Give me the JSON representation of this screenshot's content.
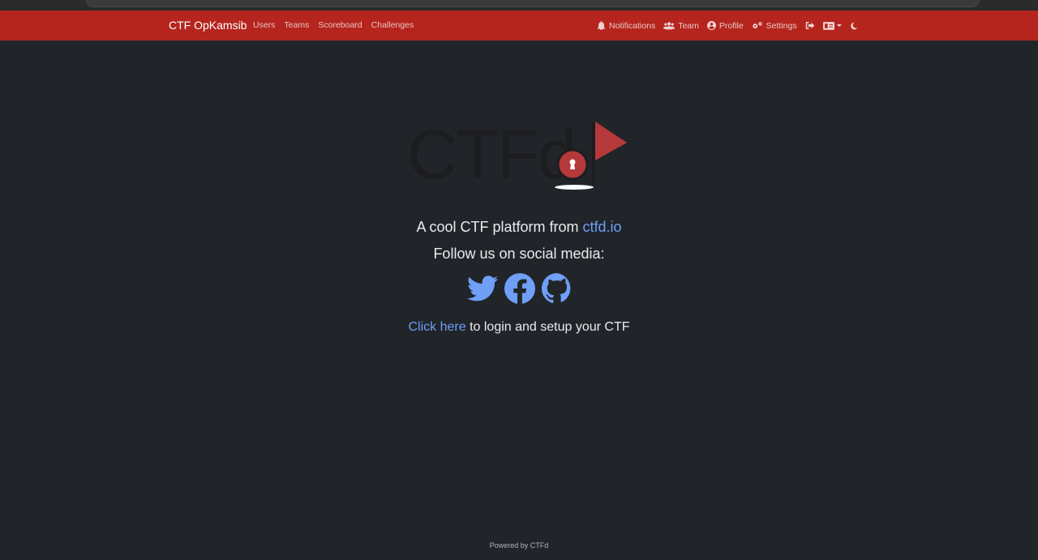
{
  "navbar": {
    "brand": "CTF OpKamsib",
    "links": [
      "Users",
      "Teams",
      "Scoreboard",
      "Challenges"
    ],
    "right": {
      "notifications": "Notifications",
      "team": "Team",
      "profile": "Profile",
      "settings": "Settings"
    }
  },
  "logo": {
    "text": "CTFd",
    "flag_color": "#b5393b"
  },
  "main": {
    "tagline_prefix": "A cool CTF platform from ",
    "tagline_link": "ctfd.io",
    "follow_text": "Follow us on social media:",
    "social": [
      "twitter-icon",
      "facebook-icon",
      "github-icon"
    ],
    "login_link": "Click here",
    "login_suffix": " to login and setup your CTF"
  },
  "footer": {
    "text": "Powered by CTFd"
  },
  "colors": {
    "navbar": "#b5251e",
    "background": "#212529",
    "link": "#6f9ff7"
  }
}
